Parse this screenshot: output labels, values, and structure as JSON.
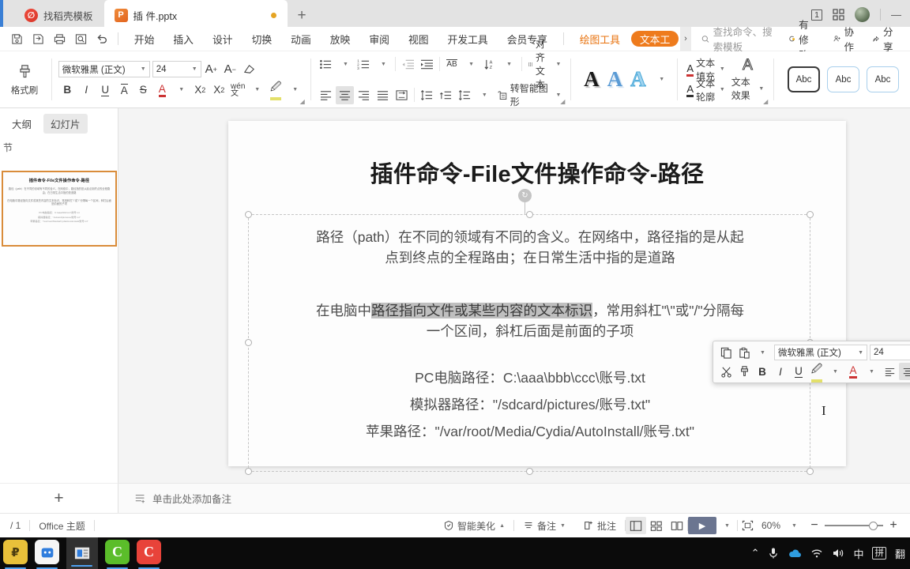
{
  "window": {
    "tabs": [
      {
        "label": "找稻壳模板",
        "icon": "docer-icon",
        "active": false
      },
      {
        "label": "插 件.pptx",
        "icon": "ppt-file-icon",
        "active": true,
        "modified": true
      }
    ],
    "new_tab_label": "+",
    "page_indicator": "1",
    "controls": {
      "minimize": "—",
      "grid": "grid-icon",
      "avatar": "user-avatar"
    }
  },
  "menubar": {
    "quick_access": [
      "save-icon",
      "save-as-icon",
      "print-icon",
      "print-preview-icon",
      "undo-icon"
    ],
    "items": [
      "开始",
      "插入",
      "设计",
      "切换",
      "动画",
      "放映",
      "审阅",
      "视图",
      "开发工具",
      "会员专享"
    ],
    "context_tabs": [
      {
        "label": "绘图工具",
        "active": false
      },
      {
        "label": "文本工",
        "active": true
      }
    ],
    "more_arrow": "›",
    "search_placeholder": "查找命令、搜索模板",
    "right_items": [
      {
        "label": "有修改",
        "icon": "sync-modified-icon"
      },
      {
        "label": "协作",
        "icon": "collaborate-icon"
      },
      {
        "label": "分享",
        "icon": "share-icon"
      }
    ]
  },
  "ribbon": {
    "format_painter": "格式刷",
    "font_name": "微软雅黑 (正文)",
    "font_size": "24",
    "font_buttons": [
      "A+",
      "A-",
      "clear-format-icon",
      "B",
      "I",
      "U",
      "A-strike-top",
      "S",
      "font-color-A",
      "X²",
      "X₂",
      "wen-pinyin",
      "highlight-icon"
    ],
    "paragraph_buttons": [
      "bullets-icon",
      "numbering-icon",
      "decrease-indent-icon",
      "increase-indent-icon",
      "text-direction-AB",
      "line-direction-icon",
      "align-text-icon",
      "align-left-icon",
      "align-center-icon",
      "align-right-icon",
      "justify-icon",
      "distribute-icon",
      "line-spacing-icon",
      "para-spacing-icon",
      "char-spacing-icon",
      "smartart-icon"
    ],
    "align_text_label": "对齐文本",
    "smartart_label": "转智能图形",
    "wordart_samples": [
      "A",
      "A",
      "A"
    ],
    "text_fill_label": "文本填充",
    "text_outline_label": "文本轮廓",
    "text_effect_label": "文本效果",
    "shape_samples": [
      "Abc",
      "Abc",
      "Abc"
    ]
  },
  "left_panel": {
    "tabs": [
      {
        "label": "大纲",
        "active": false
      },
      {
        "label": "幻灯片",
        "active": true
      }
    ],
    "section_label": "节",
    "thumbnail": {
      "title": "插件命令-File文件操作命令-路径",
      "line1": "路径（path）在不同的领域有不同的含义。在网络中，路径指的是从起点到终点的全程路由；在日常生活中指的是道路",
      "line2": "在电脑中路径指向文件或某些内容的文本标识，常用斜杠\"\\\"或\"/\"分隔每一个区间，斜杠后面是前面的子项",
      "line3": "PC电脑路径：C:\\aaa\\bbb\\ccc\\账号.txt",
      "line4": "模拟器路径：\"/sdcard/pictures/账号.txt\"",
      "line5": "苹果路径：\"/var/root/Media/Cydia/AutoInstall/账号.txt\""
    }
  },
  "slide": {
    "title": "插件命令-File文件操作命令-路径",
    "paragraph1_line1": "路径（path）在不同的领域有不同的含义。在网络中，路径指的是从起",
    "paragraph1_line2": "点到终点的全程路由；在日常生活中指的是道路",
    "paragraph2_pre": "在电脑中",
    "paragraph2_selected": "路径指向文件或某些内容的文本标识",
    "paragraph2_post": "，常用斜杠\"\\\"或\"/\"分隔每",
    "paragraph2_line2": "一个区间，斜杠后面是前面的子项",
    "path_pc": "PC电脑路径：C:\\aaa\\bbb\\ccc\\账号.txt",
    "path_emulator": "模拟器路径：\"/sdcard/pictures/账号.txt\"",
    "path_apple": "苹果路径：\"/var/root/Media/Cydia/AutoInstall/账号.txt\""
  },
  "mini_toolbar": {
    "font_name": "微软雅黑 (正文)",
    "font_size": "24",
    "buttons_row1": [
      "copy-icon",
      "paste-icon",
      "grow-font-icon",
      "shrink-font-icon"
    ],
    "buttons_row2": [
      "cut-icon",
      "format-painter-icon",
      "B",
      "I",
      "U",
      "highlight-icon",
      "font-color-icon",
      "align-left-icon",
      "align-center-icon",
      "align-right-icon",
      "line-spacing-icon",
      "bullets-icon"
    ]
  },
  "notes": {
    "add_slide_label": "+",
    "placeholder": "单击此处添加备注",
    "icon": "add-note-icon"
  },
  "statusbar": {
    "page_count": "/ 1",
    "theme": "Office 主题",
    "smart_beautify": "智能美化",
    "notes_label": "备注",
    "comments_label": "批注",
    "views": [
      "normal-view-icon",
      "slide-sorter-icon",
      "reading-view-icon"
    ],
    "play_label": "▶",
    "zoom_fit_icon": "fit-slide-icon",
    "zoom_level": "60%",
    "zoom_out": "−",
    "zoom_in": "+"
  },
  "taskbar": {
    "apps": [
      "python-64-icon",
      "robot-app-icon",
      "media-app-icon",
      "camtasia-green-icon",
      "camtasia-red-icon"
    ],
    "tray": [
      "chevron-up-icon",
      "microphone-icon",
      "onedrive-icon",
      "wifi-icon",
      "volume-icon"
    ],
    "ime_mode": "中",
    "ime_label": "拼",
    "extra_label": "翻"
  },
  "colors": {
    "accent_orange": "#ee7b1d",
    "tab_blue": "#3a7fd5",
    "thumb_border": "#d98c3a",
    "selection_gray": "#bfbfbf",
    "play_button": "#6b7590"
  }
}
